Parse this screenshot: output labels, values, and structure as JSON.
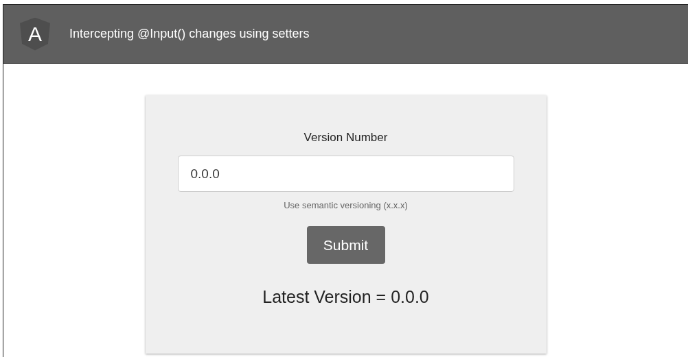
{
  "header": {
    "logo": "A",
    "title": "Intercepting @Input() changes using setters"
  },
  "form": {
    "label": "Version Number",
    "value": "0.0.0",
    "hint": "Use semantic versioning (x.x.x)",
    "button": "Submit"
  },
  "result": "Latest Version = 0.0.0"
}
